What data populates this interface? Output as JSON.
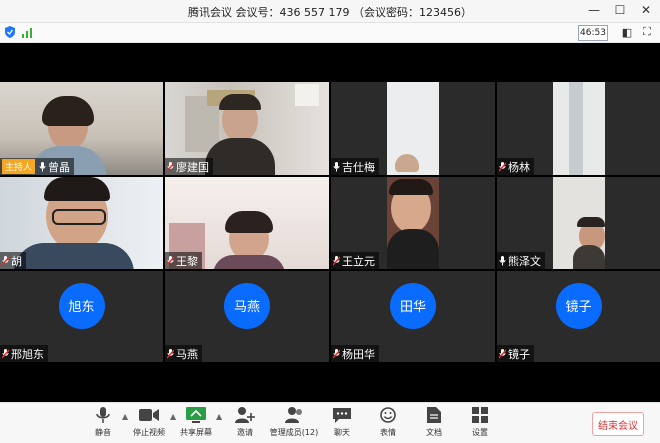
{
  "window": {
    "title": "腾讯会议 会议号：436 557 179 （会议密码：123456）"
  },
  "status": {
    "timer": "46:53"
  },
  "participants": [
    {
      "name": "曾晶",
      "host_label": "主持人",
      "mic": "on"
    },
    {
      "name": "廖建国",
      "mic": "off"
    },
    {
      "name": "吉仕梅",
      "mic": "on"
    },
    {
      "name": "杨林",
      "mic": "off"
    },
    {
      "name": "胡",
      "mic": "off"
    },
    {
      "name": "王黎",
      "mic": "off"
    },
    {
      "name": "王立元",
      "mic": "off"
    },
    {
      "name": "熊泽文",
      "mic": "on"
    },
    {
      "name": "邢旭东",
      "mic": "off",
      "avatar": "旭东"
    },
    {
      "name": "马燕",
      "mic": "off",
      "avatar": "马燕"
    },
    {
      "name": "杨田华",
      "mic": "off",
      "avatar": "田华"
    },
    {
      "name": "镜子",
      "mic": "off",
      "avatar": "镜子"
    }
  ],
  "toolbar": {
    "mute": "静音",
    "stop_video": "停止视频",
    "share_screen": "共享屏幕",
    "invite": "邀请",
    "manage_members": "管理成员(12)",
    "chat": "聊天",
    "reactions": "表情",
    "docs": "文档",
    "settings": "设置",
    "end_meeting": "结束会议"
  },
  "colors": {
    "avatar_blue": "#0a6cff",
    "host_orange": "#f5a623",
    "end_red": "#e23030"
  }
}
